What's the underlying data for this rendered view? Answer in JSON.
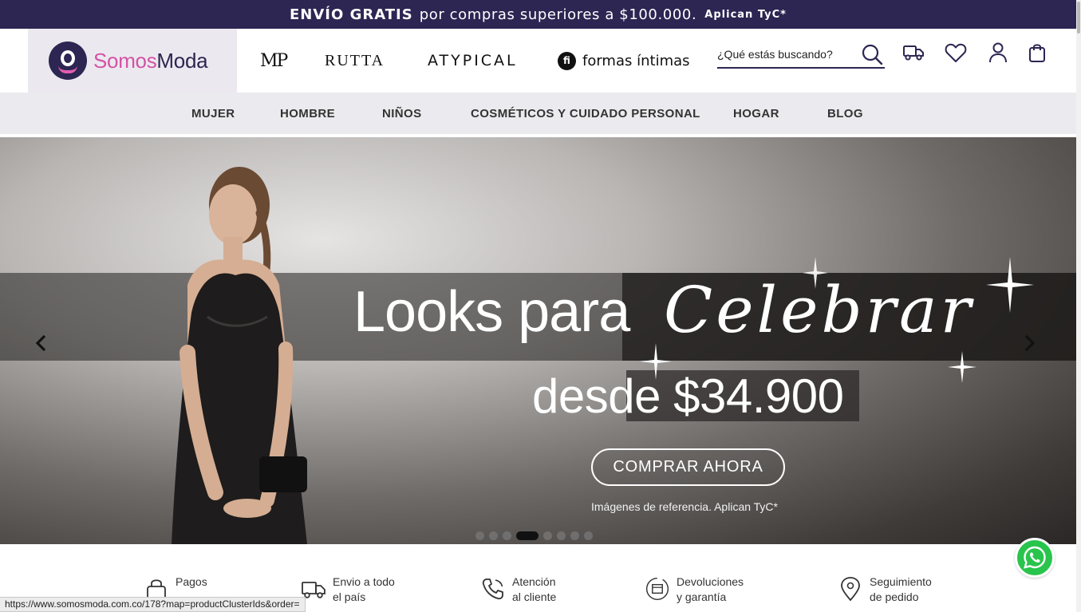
{
  "promo": {
    "bold": "ENVÍO GRATIS",
    "text": "por compras superiores a $100.000.",
    "tyc": "Aplican TyC*"
  },
  "header": {
    "logo": {
      "part1": "Somos",
      "part2": "Moda"
    },
    "brands": [
      "MP",
      "RUTTA",
      "ATYPICAL",
      "formas íntimas"
    ],
    "brand_formas_icon": "fi",
    "search_placeholder": "¿Qué estás buscando?",
    "icons": [
      "search-icon",
      "delivery-truck-icon",
      "heart-icon",
      "user-icon",
      "shopping-bag-icon"
    ]
  },
  "nav": {
    "items": [
      "MUJER",
      "HOMBRE",
      "NIÑOS",
      "COSMÉTICOS Y CUIDADO PERSONAL",
      "HOGAR",
      "BLOG"
    ]
  },
  "hero": {
    "headline": "Looks para",
    "script": "Celebrar",
    "price": "desde $34.900",
    "cta": "COMPRAR AHORA",
    "disclaimer": "Imágenes de referencia. Aplican TyC*",
    "slide_count": 8,
    "active_slide": 4
  },
  "features": [
    {
      "line1": "Pagos",
      "line2": "",
      "icon": "lock-payment-icon"
    },
    {
      "line1": "Envio a todo",
      "line2": "el país",
      "icon": "shipping-truck-icon"
    },
    {
      "line1": "Atención",
      "line2": "al cliente",
      "icon": "phone-icon"
    },
    {
      "line1": "Devoluciones",
      "line2": "y garantía",
      "icon": "return-box-icon"
    },
    {
      "line1": "Seguimiento",
      "line2": "de pedido",
      "icon": "location-pin-icon"
    }
  ],
  "statusbar": "https://www.somosmoda.com.co/178?map=productClusterIds&order=",
  "colors": {
    "brand_dark": "#2d2552",
    "brand_pink": "#d452a6",
    "whatsapp": "#29c44c",
    "nav_bg": "#ebebef"
  }
}
